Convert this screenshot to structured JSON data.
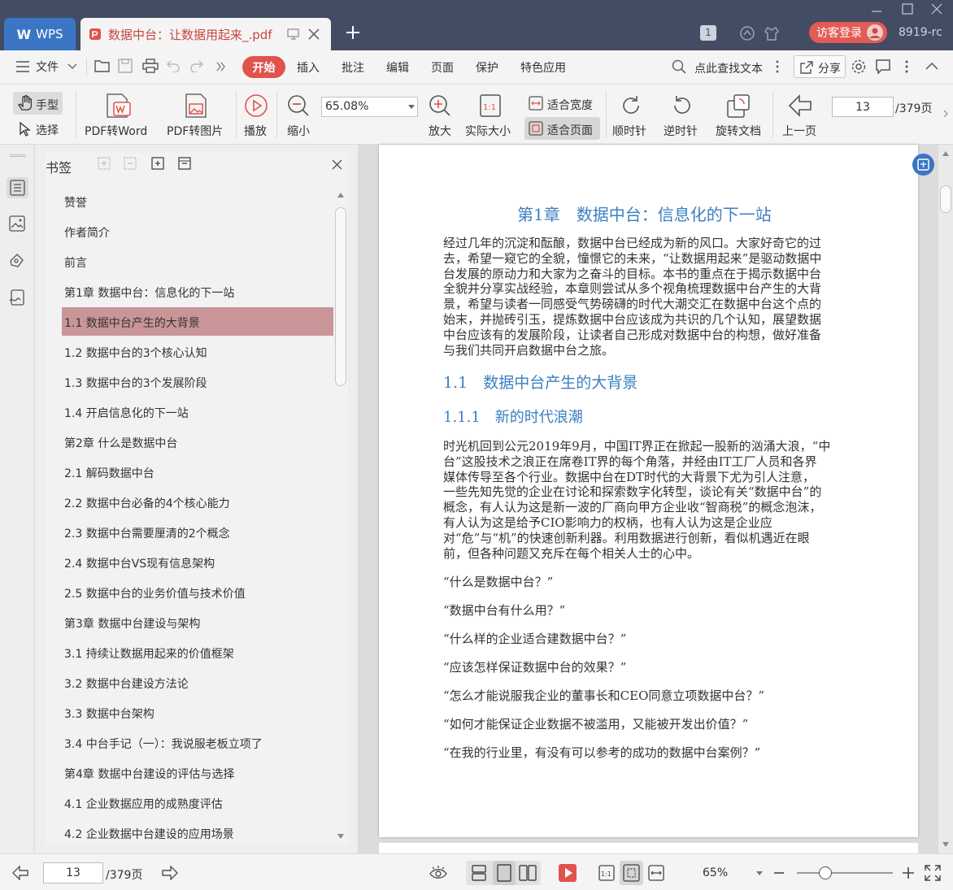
{
  "titlebar": {
    "app_tab": "WPS",
    "doc_tab": "数据中台：让数据用起来_.pdf",
    "tab_count": "1",
    "login": "访客登录",
    "user_id": "8919-rc"
  },
  "menubar": {
    "file": "文件",
    "start": "开始",
    "items": [
      "插入",
      "批注",
      "编辑",
      "页面",
      "保护",
      "特色应用"
    ],
    "search": "点此查找文本",
    "share": "分享"
  },
  "toolbar": {
    "hand": "手型",
    "select": "选择",
    "pdf_to_word": "PDF转Word",
    "pdf_to_image": "PDF转图片",
    "play": "播放",
    "zoom_out": "缩小",
    "zoom_value": "65.08%",
    "zoom_in": "放大",
    "actual_size": "实际大小",
    "fit_width": "适合宽度",
    "fit_page": "适合页面",
    "clockwise": "顺时针",
    "counterclockwise": "逆时针",
    "rotate_doc": "旋转文档",
    "prev_page": "上一页",
    "page_value": "13",
    "page_total": "/379页"
  },
  "panel": {
    "title": "书签",
    "items": [
      "赞誉",
      "作者简介",
      "前言",
      "第1章 数据中台：信息化的下一站",
      "1.1 数据中台产生的大背景",
      "1.2 数据中台的3个核心认知",
      "1.3 数据中台的3个发展阶段",
      "1.4 开启信息化的下一站",
      "第2章 什么是数据中台",
      "2.1 解码数据中台",
      "2.2 数据中台必备的4个核心能力",
      "2.3 数据中台需要厘清的2个概念",
      "2.4 数据中台VS现有信息架构",
      "2.5 数据中台的业务价值与技术价值",
      "第3章 数据中台建设与架构",
      "3.1 持续让数据用起来的价值框架",
      "3.2 数据中台建设方法论",
      "3.3 数据中台架构",
      "3.4 中台手记（一）：我说服老板立项了",
      "第4章 数据中台建设的评估与选择",
      "4.1 企业数据应用的成熟度评估",
      "4.2 企业数据中台建设的应用场景"
    ],
    "selected_index": 4
  },
  "document": {
    "chapter_title": "第1章　数据中台：信息化的下一站",
    "intro_lines": [
      "经过几年的沉淀和酝酿，数据中台已经成为新的风口。大家好奇它的过",
      "去，希望一窥它的全貌，憧憬它的未来，“让数据用起来”是驱动数据中",
      "台发展的原动力和大家为之奋斗的目标。本书的重点在于揭示数据中台",
      "全貌并分享实战经验，本章则尝试从多个视角梳理数据中台产生的大背",
      "景，希望与读者一同感受气势磅礴的时代大潮交汇在数据中台这个点的",
      "始末，并抛砖引玉，提炼数据中台应该成为共识的几个认知，展望数据",
      "中台应该有的发展阶段，让读者自己形成对数据中台的构想，做好准备",
      "与我们共同开启数据中台之旅。"
    ],
    "section_title": "1.1　数据中台产生的大背景",
    "subsection_title": "1.1.1　新的时代浪潮",
    "body_lines": [
      "时光机回到公元2019年9月，中国IT界正在掀起一股新的汹涌大浪，“中",
      "台”这股技术之浪正在席卷IT界的每个角落，并经由IT工厂人员和各界",
      "媒体传导至各个行业。数据中台在DT时代的大背景下尤为引人注意，",
      "一些先知先觉的企业在讨论和探索数字化转型，谈论有关“数据中台”的",
      "概念，有人认为这是新一波的厂商向甲方企业收“智商税”的概念泡沫，",
      "有人认为这是给予CIO影响力的权柄，也有人认为这是企业应",
      "对“危”与“机”的快速创新利器。利用数据进行创新，看似机遇近在眼",
      "前，但各种问题又充斥在每个相关人士的心中。"
    ],
    "questions": [
      "“什么是数据中台？”",
      "“数据中台有什么用？”",
      "“什么样的企业适合建数据中台？”",
      "“应该怎样保证数据中台的效果？”",
      "“怎么才能说服我企业的董事长和CEO同意立项数据中台？”",
      "“如何才能保证企业数据不被滥用，又能被开发出价值？”",
      "“在我的行业里，有没有可以参考的成功的数据中台案例？”"
    ]
  },
  "statusbar": {
    "page_value": "13",
    "page_total": "/379页",
    "zoom": "65%"
  },
  "colors": {
    "accent_red": "#e0534c",
    "heading_blue": "#3b7fc0",
    "selected_bookmark": "#c99599",
    "titlebar": "#434c63"
  }
}
